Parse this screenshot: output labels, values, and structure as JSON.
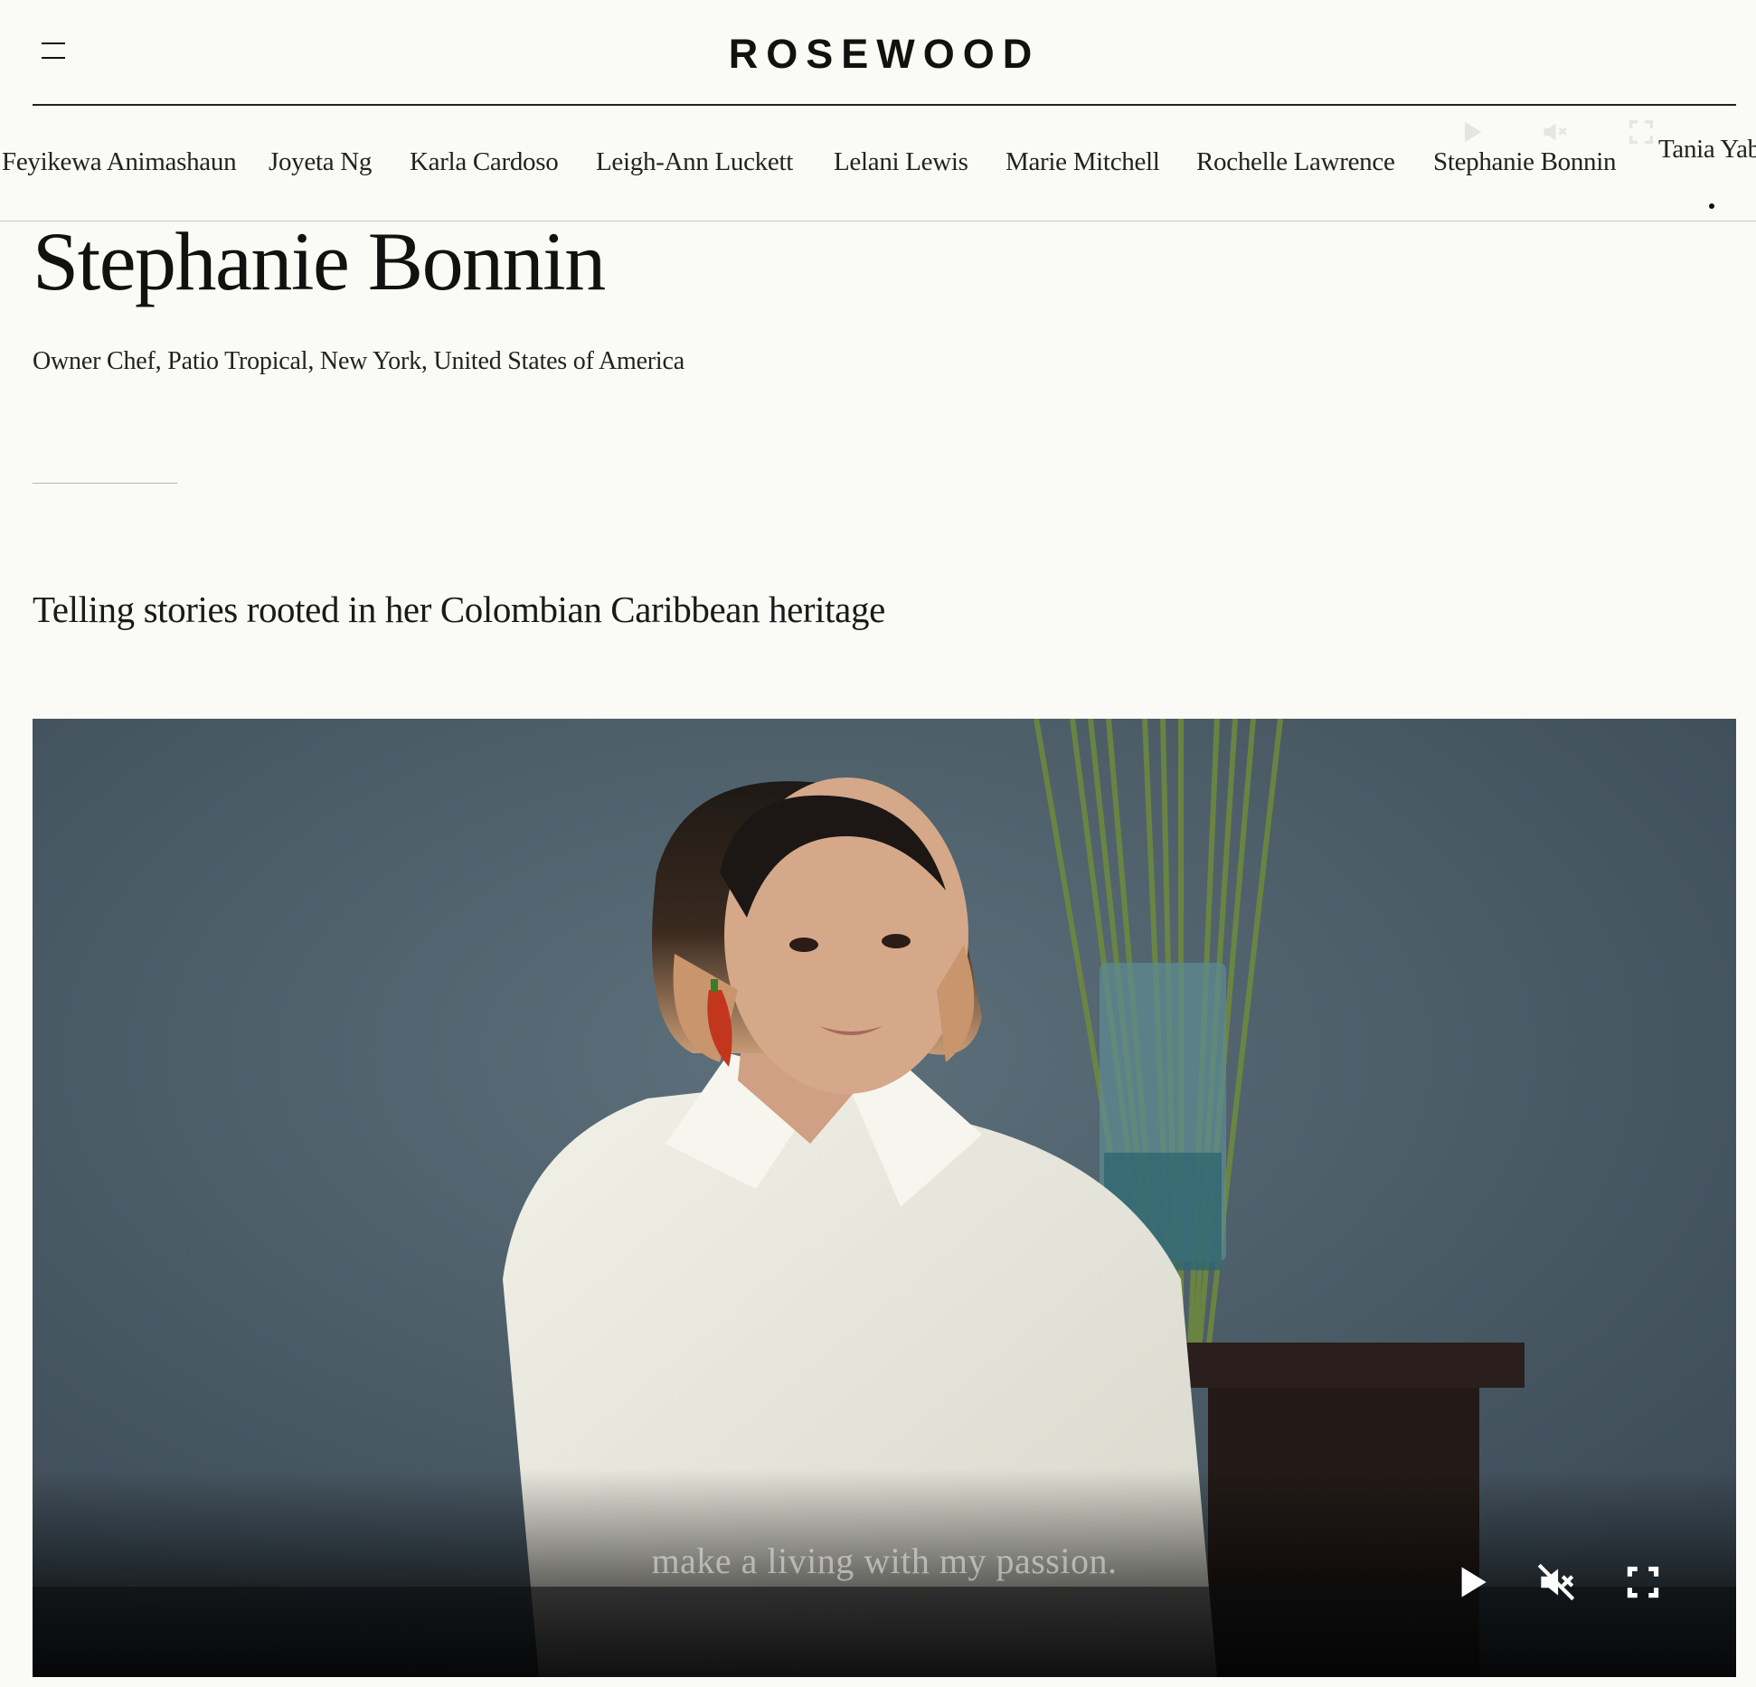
{
  "header": {
    "logo": "ROSEWOOD",
    "menu_icon": "hamburger-menu-icon"
  },
  "names_strip": {
    "items": [
      "Feyikewa Animashaun",
      "Joyeta Ng",
      "Karla Cardoso",
      "Leigh-Ann Luckett",
      "Lelani Lewis",
      "Marie Mitchell",
      "Rochelle Lawrence",
      "Stephanie Bonnin",
      "Tania Yab"
    ]
  },
  "profile": {
    "name": "Stephanie Bonnin",
    "role": "Owner Chef, Patio Tropical, New York, United States of America",
    "tagline": "Telling stories rooted in her Colombian Caribbean heritage"
  },
  "video": {
    "caption": "make a living with my passion.",
    "controls": {
      "play_icon": "play-icon",
      "mute_icon": "volume-muted-icon",
      "fullscreen_icon": "fullscreen-icon"
    }
  },
  "colors": {
    "background": "#fafaf6",
    "text": "#111111",
    "video_bg": "#4a5c68"
  }
}
